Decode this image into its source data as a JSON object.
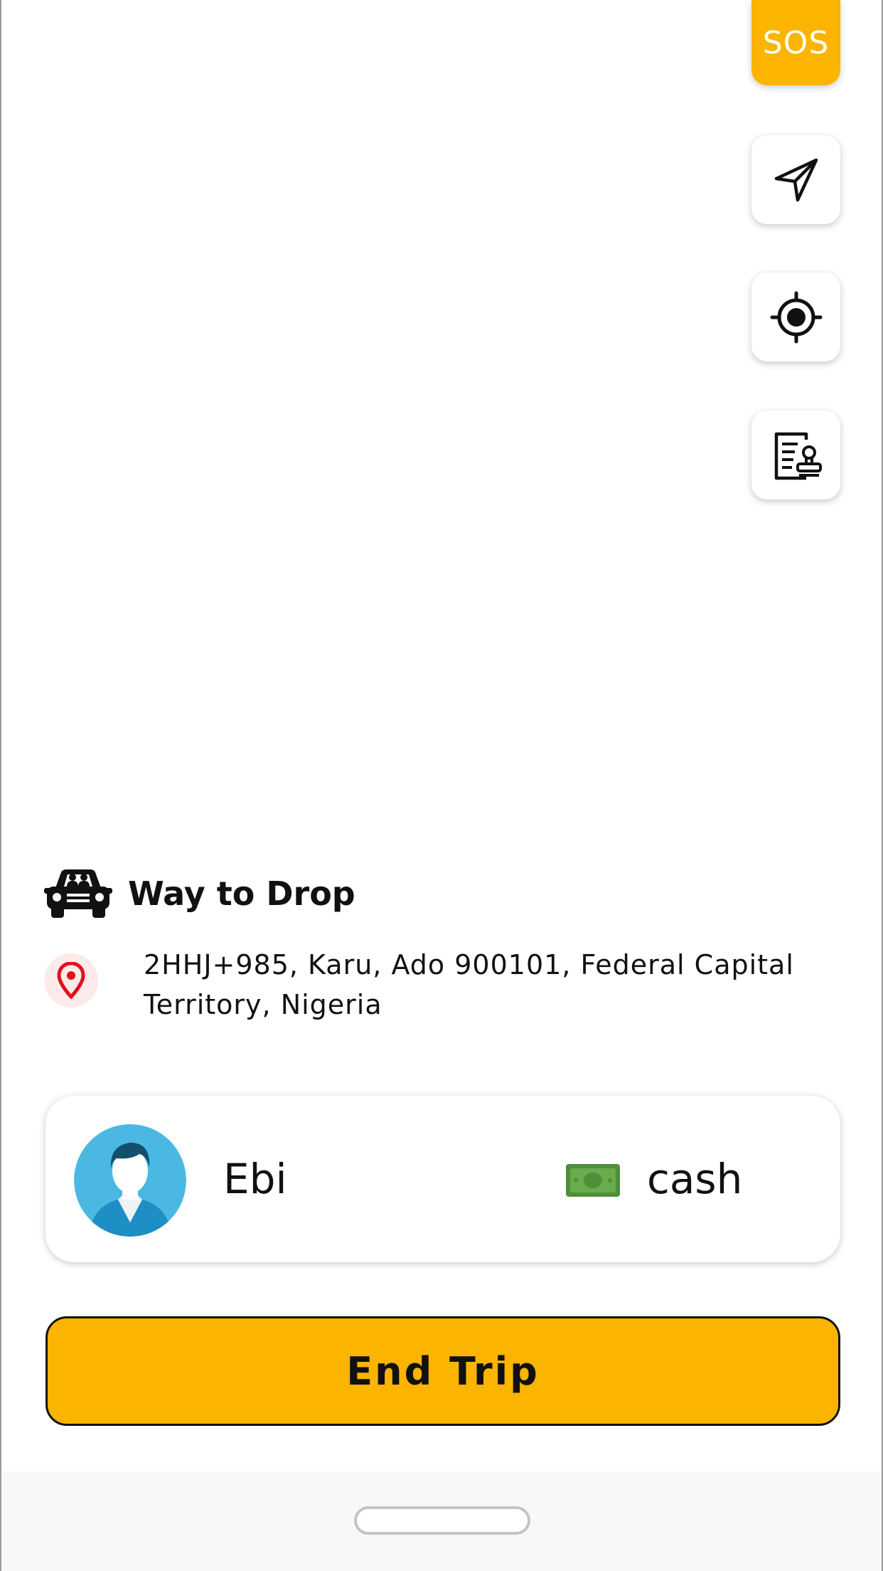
{
  "sos_button": {
    "label": "SOS"
  },
  "map_controls": {
    "navigate_icon": "paper-plane-icon",
    "locate_icon": "crosshair-target-icon",
    "details_icon": "document-stamp-icon"
  },
  "drop": {
    "title": "Way to Drop",
    "address": "2HHJ+985, Karu, Ado 900101, Federal Capital Territory, Nigeria"
  },
  "rider": {
    "name": "Ebi",
    "payment_method": "cash"
  },
  "actions": {
    "end_trip_label": "End Trip"
  },
  "colors": {
    "accent": "#fbb400",
    "pin": "#e3101c",
    "cash_green": "#4e8f3a",
    "avatar_blue": "#4ab8e3"
  }
}
